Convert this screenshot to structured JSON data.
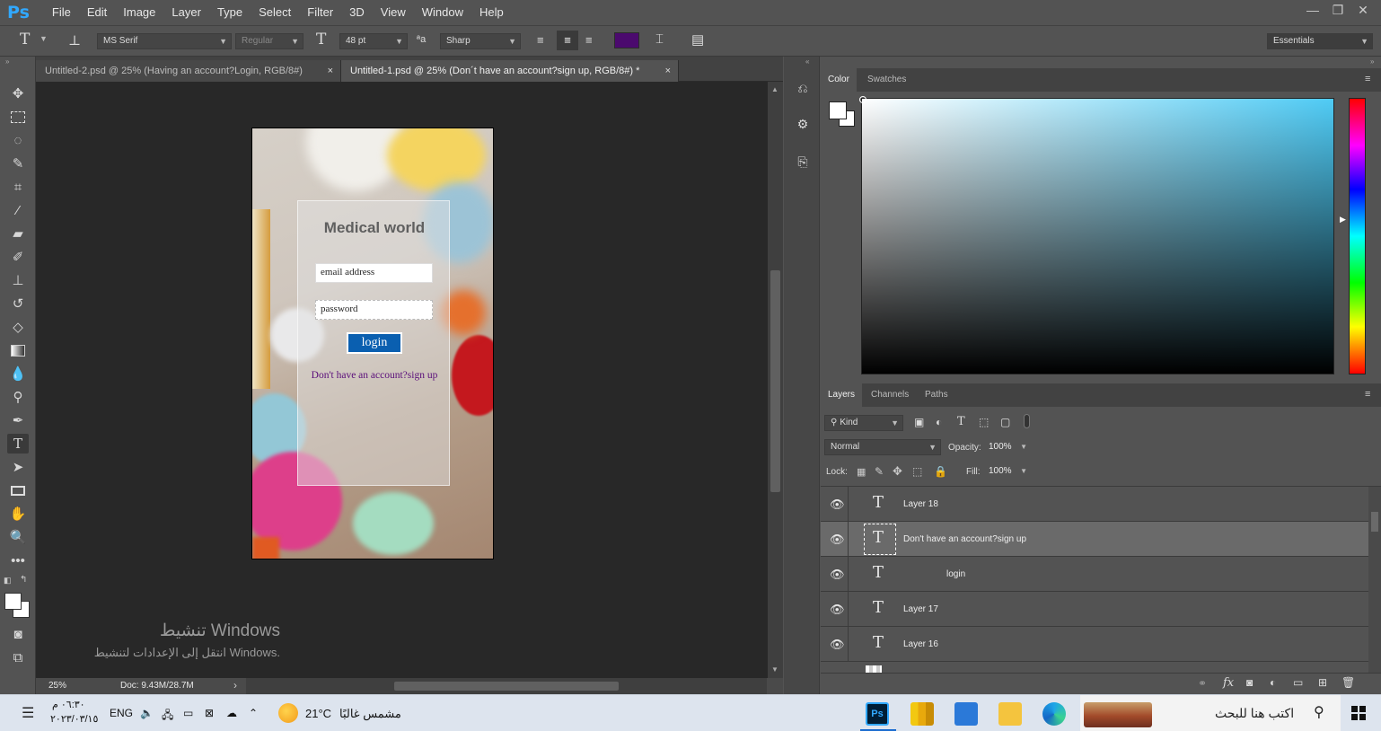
{
  "app": {
    "logo": "Ps"
  },
  "menu": [
    "File",
    "Edit",
    "Image",
    "Layer",
    "Type",
    "Select",
    "Filter",
    "3D",
    "View",
    "Window",
    "Help"
  ],
  "window_controls": {
    "minimize": "—",
    "restore": "❐",
    "close": "✕"
  },
  "options": {
    "tool_glyph": "T",
    "font_family": "MS Serif",
    "font_style": "Regular",
    "font_size": "48 pt",
    "antialias_icon": "ªa",
    "antialias": "Sharp",
    "text_color": "#4b0a6e",
    "workspace": "Essentials"
  },
  "tabs": [
    {
      "title": "Untitled-2.psd @ 25% (Having an account?Login, RGB/8#)",
      "close": "×",
      "active": false
    },
    {
      "title": "Untitled-1.psd @ 25% (Don´t have an account?sign up, RGB/8#) *",
      "close": "×",
      "active": true
    }
  ],
  "tools": [
    "move-icon",
    "marquee-icon",
    "lasso-icon",
    "quick-select-icon",
    "crop-icon",
    "eyedropper-icon",
    "healing-icon",
    "brush-icon",
    "stamp-icon",
    "history-brush-icon",
    "eraser-icon",
    "gradient-icon",
    "blur-icon",
    "dodge-icon",
    "pen-icon",
    "type-icon",
    "path-select-icon",
    "rectangle-icon",
    "hand-icon",
    "zoom-icon",
    "more-icon"
  ],
  "design": {
    "title": "Medical world",
    "email_placeholder": "email address",
    "password_placeholder": "password",
    "login_label": "login",
    "signup_text": "Don't have an account?sign up"
  },
  "status": {
    "zoom": "25%",
    "doc": "Doc: 9.43M/28.7M",
    "arrow": "›"
  },
  "watermark": {
    "line1": "تنشيط Windows",
    "line2": "انتقل إلى الإعدادات لتنشيط Windows."
  },
  "color_panel": {
    "tab_color": "Color",
    "tab_swatches": "Swatches",
    "hue_top": "#4fcbf5",
    "fg": "#ffffff",
    "bg": "#ffffff"
  },
  "layers_panel": {
    "tab_layers": "Layers",
    "tab_channels": "Channels",
    "tab_paths": "Paths",
    "kind": "Kind",
    "blend": "Normal",
    "opacity_label": "Opacity:",
    "opacity": "100%",
    "lock_label": "Lock:",
    "fill_label": "Fill:",
    "fill": "100%",
    "layers": [
      {
        "name": "Layer 18",
        "selected": false
      },
      {
        "name": "Don't have an account?sign up",
        "selected": true
      },
      {
        "name": "login",
        "selected": false
      },
      {
        "name": "Layer 17",
        "selected": false
      },
      {
        "name": "Layer 16",
        "selected": false
      }
    ]
  },
  "taskbar": {
    "search_placeholder": "اكتب هنا للبحث",
    "weather_temp": "21°C",
    "weather_text": "مشمس غالبًا",
    "lang": "ENG",
    "time": "٠٦:٣٠ م",
    "date": "٢٠٢٣/٠٣/١٥"
  }
}
